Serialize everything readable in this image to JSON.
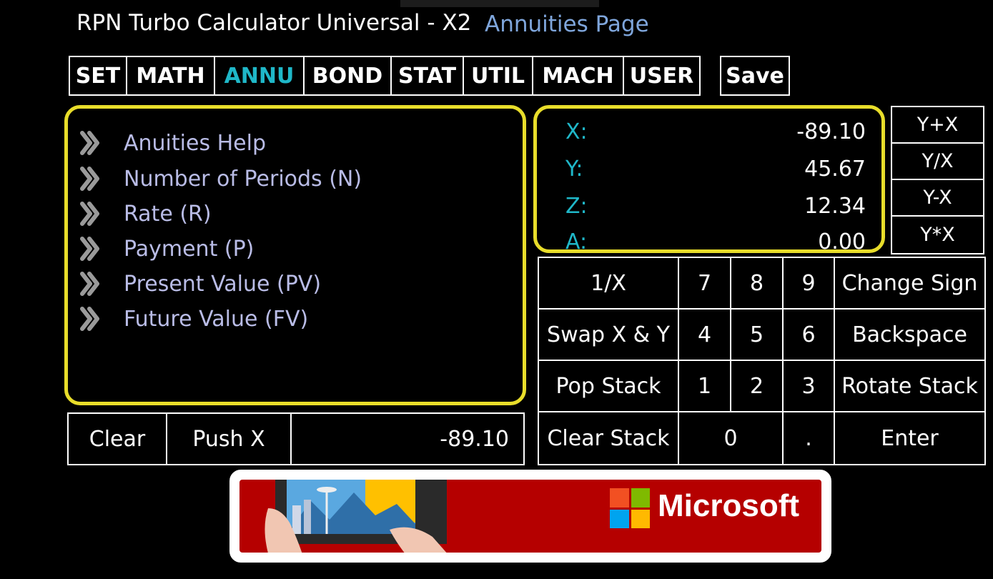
{
  "app": {
    "title": "RPN Turbo Calculator Universal - X2",
    "page": "Annuities Page"
  },
  "nav": {
    "tabs": [
      "SET",
      "MATH",
      "ANNU",
      "BOND",
      "STAT",
      "UTIL",
      "MACH",
      "USER"
    ],
    "active": "ANNU",
    "save_label": "Save"
  },
  "menu": {
    "items": [
      "Anuities Help",
      "Number of Periods (N)",
      "Rate (R)",
      "Payment (P)",
      "Present Value (PV)",
      "Future Value (FV)"
    ]
  },
  "bottom": {
    "clear_label": "Clear",
    "push_label": "Push X",
    "entry_value": "-89.10"
  },
  "stack": [
    {
      "label": "X:",
      "value": "-89.10"
    },
    {
      "label": "Y:",
      "value": "45.67"
    },
    {
      "label": "Z:",
      "value": "12.34"
    },
    {
      "label": "A:",
      "value": "0.00"
    }
  ],
  "ops": [
    "Y+X",
    "Y/X",
    "Y-X",
    "Y*X"
  ],
  "keypad": [
    [
      "1/X",
      "7",
      "8",
      "9",
      "Change Sign"
    ],
    [
      "Swap X & Y",
      "4",
      "5",
      "6",
      "Backspace"
    ],
    [
      "Pop Stack",
      "1",
      "2",
      "3",
      "Rotate Stack"
    ],
    [
      "Clear Stack",
      "0",
      ".",
      "Enter"
    ]
  ],
  "ad": {
    "brand": "Microsoft",
    "colors": {
      "bg": "#b50000",
      "red": "#f25022",
      "green": "#7fba00",
      "blue": "#00a4ef",
      "yellow": "#ffb900"
    }
  },
  "colors": {
    "accent": "#1fb7c8",
    "panel_border": "#e8dd2a",
    "menu_text": "#b9bce6",
    "subtitle": "#7fa6dc"
  }
}
